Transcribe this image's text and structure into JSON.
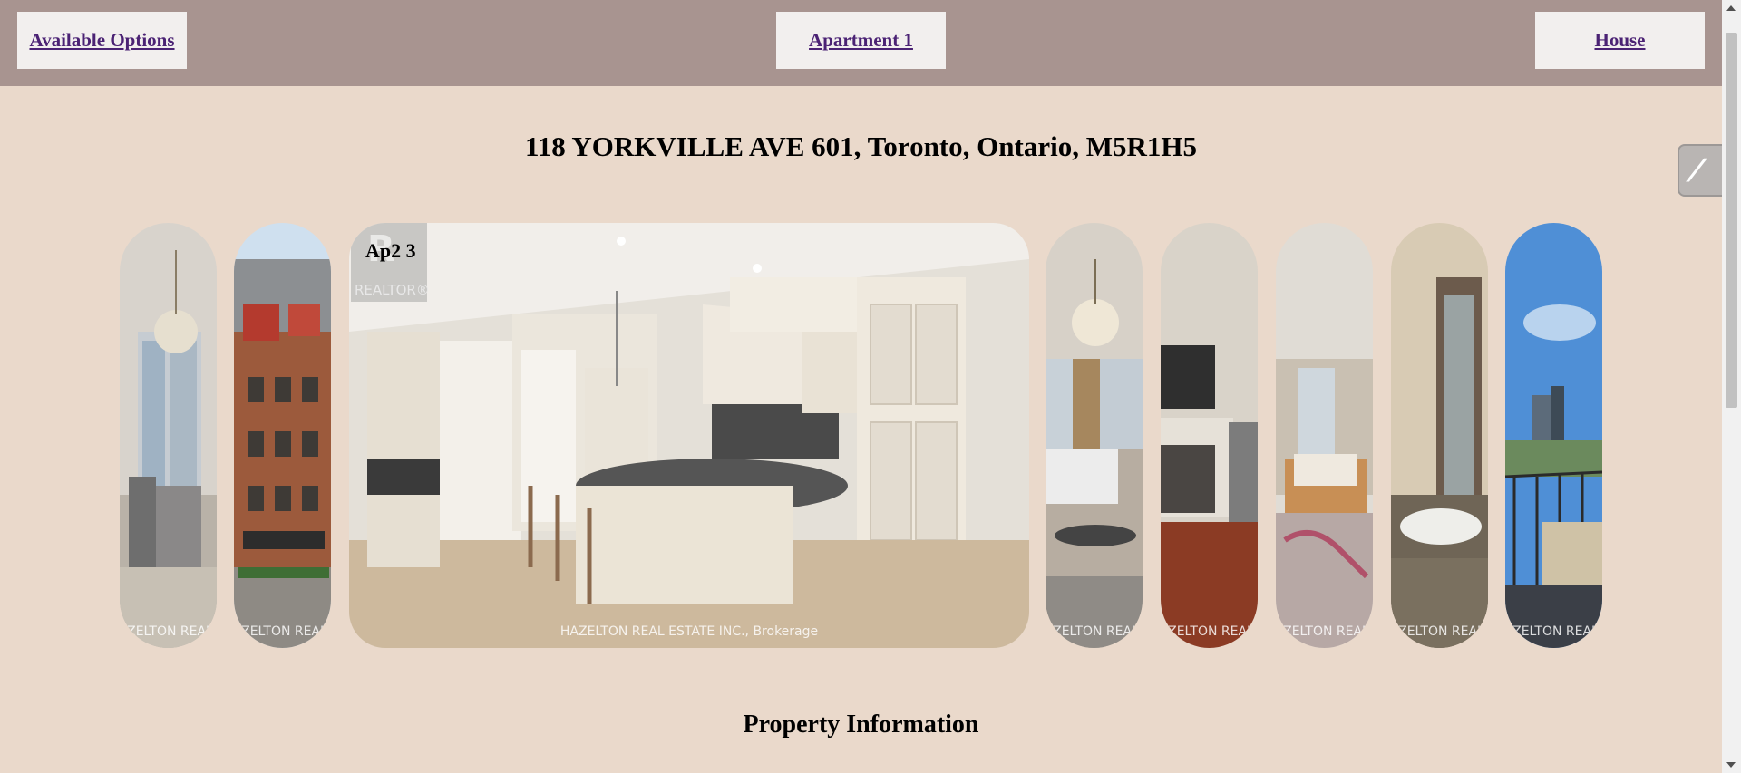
{
  "nav": {
    "options": "Available Options",
    "apartment": "Apartment 1",
    "house": "House"
  },
  "page": {
    "title": "118 YORKVILLE AVE 601, Toronto, Ontario, M5R1H5"
  },
  "gallery": {
    "active_label": "Ap2 3",
    "watermark": "HAZELTON REAL ESTATE INC., Brokerage",
    "realtor_logo_text": "REALTOR®",
    "photos": [
      {
        "name": "dining-room-photo"
      },
      {
        "name": "building-exterior-photo"
      },
      {
        "name": "kitchen-photo"
      },
      {
        "name": "living-room-chandelier-photo"
      },
      {
        "name": "fireplace-photo"
      },
      {
        "name": "living-room-photo"
      },
      {
        "name": "bathroom-photo"
      },
      {
        "name": "balcony-view-photo"
      }
    ]
  },
  "sections": {
    "property_info": "Property Information"
  },
  "colors": {
    "background": "#ead9cb",
    "topbar": "#a89490",
    "link": "#4b2274"
  },
  "icons": {
    "floating_action": "slash-logo-icon"
  }
}
